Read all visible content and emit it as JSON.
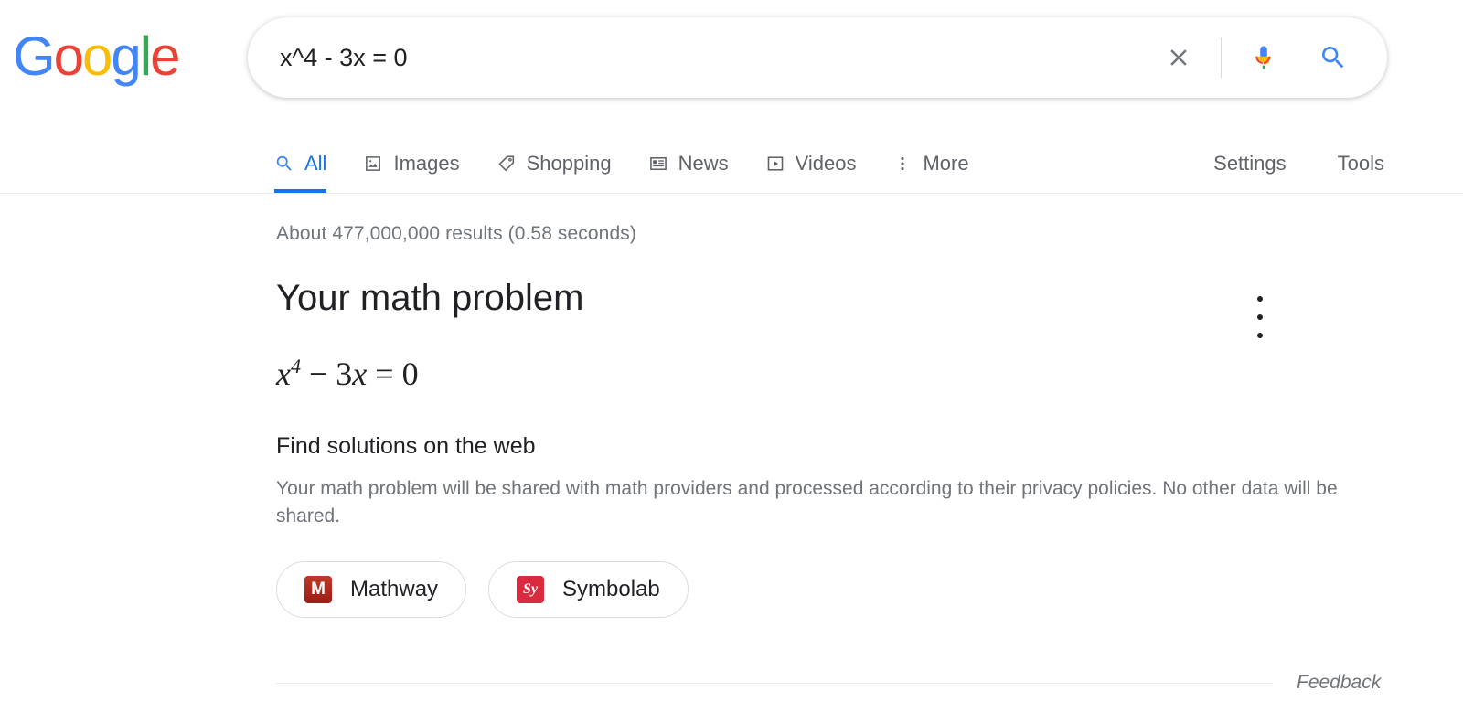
{
  "brand": {
    "name": "Google",
    "letters": [
      {
        "ch": "G",
        "color": "#4285f4"
      },
      {
        "ch": "o",
        "color": "#ea4335"
      },
      {
        "ch": "o",
        "color": "#fbbc05"
      },
      {
        "ch": "g",
        "color": "#4285f4"
      },
      {
        "ch": "l",
        "color": "#34a853"
      },
      {
        "ch": "e",
        "color": "#ea4335"
      }
    ]
  },
  "search": {
    "query": "x^4 - 3x = 0",
    "placeholder": "Search",
    "clear_icon": "close-icon",
    "mic_icon": "microphone-icon",
    "search_icon": "search-icon"
  },
  "nav": {
    "tabs": [
      {
        "label": "All",
        "icon": "search-icon",
        "active": true
      },
      {
        "label": "Images",
        "icon": "image-icon",
        "active": false
      },
      {
        "label": "Shopping",
        "icon": "tag-icon",
        "active": false
      },
      {
        "label": "News",
        "icon": "newspaper-icon",
        "active": false
      },
      {
        "label": "Videos",
        "icon": "video-icon",
        "active": false
      },
      {
        "label": "More",
        "icon": "more-vertical-icon",
        "active": false
      }
    ],
    "links": [
      {
        "label": "Settings"
      },
      {
        "label": "Tools"
      }
    ],
    "active_color": "#1a73e8"
  },
  "results": {
    "stats": "About 477,000,000 results (0.58 seconds)"
  },
  "math_card": {
    "title": "Your math problem",
    "equation": {
      "base": "x",
      "exponent": "4",
      "operator": "−",
      "coefficient": "3",
      "variable": "x",
      "equals": "=",
      "rhs": "0",
      "plain": "x^4 - 3x = 0"
    },
    "subheading": "Find solutions on the web",
    "disclaimer": "Your math problem will be shared with math providers and processed according to their privacy policies. No other data will be shared.",
    "providers": [
      {
        "label": "Mathway",
        "icon_text": "M",
        "icon_color": "#a3180f"
      },
      {
        "label": "Symbolab",
        "icon_text": "Sy",
        "icon_color": "#d92b3f"
      }
    ],
    "overflow_icon": "more-vertical-icon"
  },
  "footer": {
    "feedback": "Feedback"
  }
}
